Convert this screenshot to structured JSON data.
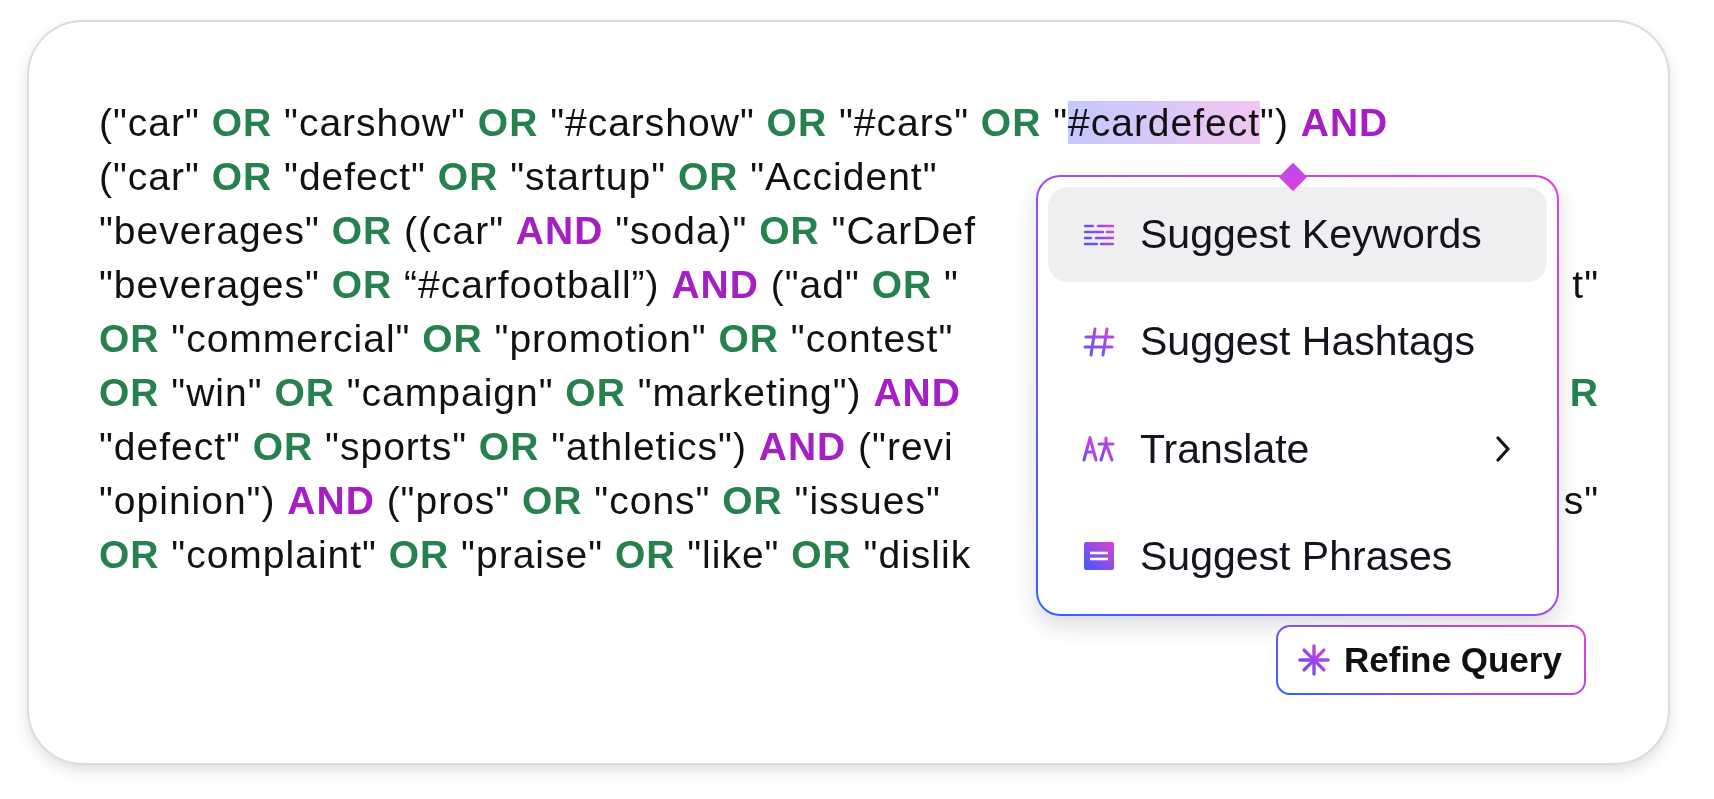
{
  "query": {
    "lines": [
      {
        "segments": [
          {
            "kind": "text",
            "text": "(\"car\" "
          },
          {
            "kind": "or",
            "text": "OR"
          },
          {
            "kind": "text",
            "text": " \"carshow\" "
          },
          {
            "kind": "or",
            "text": "OR"
          },
          {
            "kind": "text",
            "text": " \"#carshow\" "
          },
          {
            "kind": "or",
            "text": "OR"
          },
          {
            "kind": "text",
            "text": " \"#cars\" "
          },
          {
            "kind": "or",
            "text": "OR"
          },
          {
            "kind": "text",
            "text": " \""
          },
          {
            "kind": "text",
            "text": "#cardefect",
            "highlighted": true
          },
          {
            "kind": "text",
            "text": "\") "
          },
          {
            "kind": "and",
            "text": "AND"
          }
        ]
      },
      {
        "segments": [
          {
            "kind": "text",
            "text": "(\"car\" "
          },
          {
            "kind": "or",
            "text": "OR"
          },
          {
            "kind": "text",
            "text": " \"defect\" "
          },
          {
            "kind": "or",
            "text": "OR"
          },
          {
            "kind": "text",
            "text": " \"startup\" "
          },
          {
            "kind": "or",
            "text": "OR"
          },
          {
            "kind": "text",
            "text": " \"Accident\""
          }
        ]
      },
      {
        "segments": [
          {
            "kind": "text",
            "text": "\"beverages\" "
          },
          {
            "kind": "or",
            "text": "OR"
          },
          {
            "kind": "text",
            "text": " ((car\" "
          },
          {
            "kind": "and",
            "text": "AND"
          },
          {
            "kind": "text",
            "text": " \"soda)\" "
          },
          {
            "kind": "or",
            "text": "OR"
          },
          {
            "kind": "text",
            "text": " \"CarDef"
          }
        ]
      },
      {
        "segments": [
          {
            "kind": "text",
            "text": "\"beverages\" "
          },
          {
            "kind": "or",
            "text": "OR"
          },
          {
            "kind": "text",
            "text": " “#carfootball”) "
          },
          {
            "kind": "and",
            "text": "AND"
          },
          {
            "kind": "text",
            "text": " (\"ad\" "
          },
          {
            "kind": "or",
            "text": "OR"
          },
          {
            "kind": "text",
            "text": " \""
          }
        ],
        "tail": {
          "kind": "text",
          "text": "t\""
        }
      },
      {
        "segments": [
          {
            "kind": "or",
            "text": "OR"
          },
          {
            "kind": "text",
            "text": " \"commercial\" "
          },
          {
            "kind": "or",
            "text": "OR"
          },
          {
            "kind": "text",
            "text": " \"promotion\" "
          },
          {
            "kind": "or",
            "text": "OR"
          },
          {
            "kind": "text",
            "text": " \"contest\""
          }
        ]
      },
      {
        "segments": [
          {
            "kind": "or",
            "text": "OR"
          },
          {
            "kind": "text",
            "text": " \"win\" "
          },
          {
            "kind": "or",
            "text": "OR"
          },
          {
            "kind": "text",
            "text": " \"campaign\" "
          },
          {
            "kind": "or",
            "text": "OR"
          },
          {
            "kind": "text",
            "text": " \"marketing\") "
          },
          {
            "kind": "and",
            "text": "AND"
          }
        ],
        "tail": {
          "kind": "or",
          "text": "R"
        }
      },
      {
        "segments": [
          {
            "kind": "text",
            "text": "\"defect\" "
          },
          {
            "kind": "or",
            "text": "OR"
          },
          {
            "kind": "text",
            "text": " \"sports\" "
          },
          {
            "kind": "or",
            "text": "OR"
          },
          {
            "kind": "text",
            "text": " \"athletics\") "
          },
          {
            "kind": "and",
            "text": "AND"
          },
          {
            "kind": "text",
            "text": " (\"revi"
          }
        ]
      },
      {
        "segments": [
          {
            "kind": "text",
            "text": "\"opinion\") "
          },
          {
            "kind": "and",
            "text": "AND"
          },
          {
            "kind": "text",
            "text": " (\"pros\" "
          },
          {
            "kind": "or",
            "text": "OR"
          },
          {
            "kind": "text",
            "text": " \"cons\" "
          },
          {
            "kind": "or",
            "text": "OR"
          },
          {
            "kind": "text",
            "text": " \"issues\""
          }
        ],
        "tail": {
          "kind": "text",
          "text": "s\""
        }
      },
      {
        "segments": [
          {
            "kind": "or",
            "text": "OR"
          },
          {
            "kind": "text",
            "text": " \"complaint\" "
          },
          {
            "kind": "or",
            "text": "OR"
          },
          {
            "kind": "text",
            "text": " \"praise\" "
          },
          {
            "kind": "or",
            "text": "OR"
          },
          {
            "kind": "text",
            "text": " \"like\" "
          },
          {
            "kind": "or",
            "text": "OR"
          },
          {
            "kind": "text",
            "text": " \"dislik"
          }
        ]
      }
    ]
  },
  "menu": {
    "items": [
      {
        "label": "Suggest Keywords",
        "selected": true,
        "has_submenu": false
      },
      {
        "label": "Suggest Hashtags",
        "selected": false,
        "has_submenu": false
      },
      {
        "label": "Translate",
        "selected": false,
        "has_submenu": true
      },
      {
        "label": "Suggest Phrases",
        "selected": false,
        "has_submenu": false
      }
    ]
  },
  "refine_button": {
    "label": "Refine Query"
  }
}
